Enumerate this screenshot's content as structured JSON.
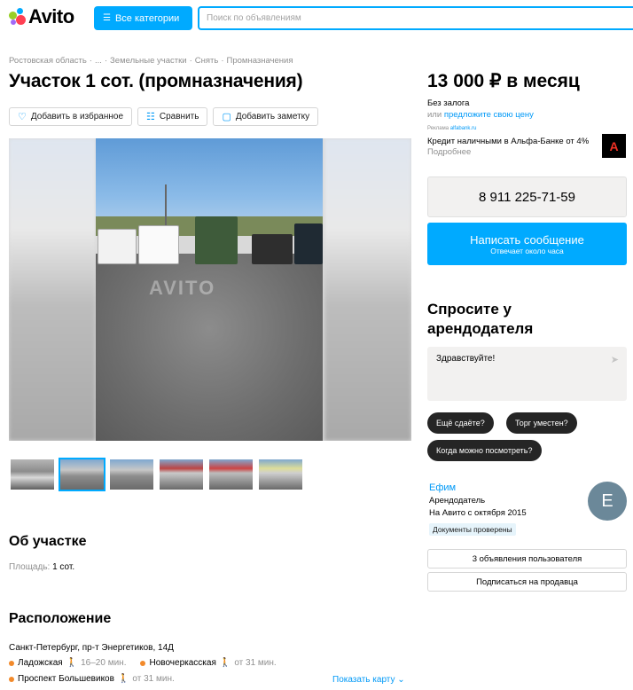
{
  "header": {
    "logo_text": "Avito",
    "categories_label": "Все категории",
    "search_placeholder": "Поиск по объявлениям"
  },
  "breadcrumbs": [
    "Ростовская область",
    "...",
    "Земельные участки",
    "Снять",
    "Промназначения"
  ],
  "listing": {
    "title": "Участок 1 сот. (промназначения)",
    "actions": {
      "favorite": "Добавить в избранное",
      "compare": "Сравнить",
      "note": "Добавить заметку"
    },
    "watermark": "AVITO",
    "thumbnails_count": 6,
    "active_thumbnail": 1
  },
  "about": {
    "heading": "Об участке",
    "area_label": "Площадь:",
    "area_value": "1 сот."
  },
  "location": {
    "heading": "Расположение",
    "address": "Санкт-Петербург, пр-т Энергетиков, 14Д",
    "metro": [
      {
        "name": "Ладожская",
        "time": "16–20 мин."
      },
      {
        "name": "Новочеркасская",
        "time": "от 31 мин."
      },
      {
        "name": "Проспект Большевиков",
        "time": "от 31 мин."
      }
    ],
    "show_map": "Показать карту"
  },
  "sidebar": {
    "price": "13 000 ₽ в месяц",
    "deposit": "Без залога",
    "offer_prefix": "или",
    "offer_link": "предложите свою цену",
    "ad_label": "Реклама",
    "ad_source": "alfabank.ru",
    "ad_text": "Кредит наличными в Альфа-Банке от 4%",
    "ad_more": "Подробнее",
    "ad_logo": "А",
    "phone": "8 911 225-71-59",
    "message_main": "Написать сообщение",
    "message_sub": "Отвечает около часа",
    "ask_heading": "Спросите у арендодателя",
    "ask_text": "Здравствуйте!",
    "chips": [
      "Ещё сдаёте?",
      "Торг уместен?",
      "Когда можно посмотреть?"
    ],
    "seller": {
      "name": "Ефим",
      "role": "Арендодатель",
      "since": "На Авито с октября 2015",
      "docs": "Документы проверены",
      "avatar_letter": "E"
    },
    "user_listings": "3 объявления пользователя",
    "subscribe": "Подписаться на продавца"
  },
  "colors": {
    "accent": "#00aaff",
    "link": "#0099f7",
    "dark_chip": "#252525",
    "metro_dot": "#f28a2b"
  }
}
